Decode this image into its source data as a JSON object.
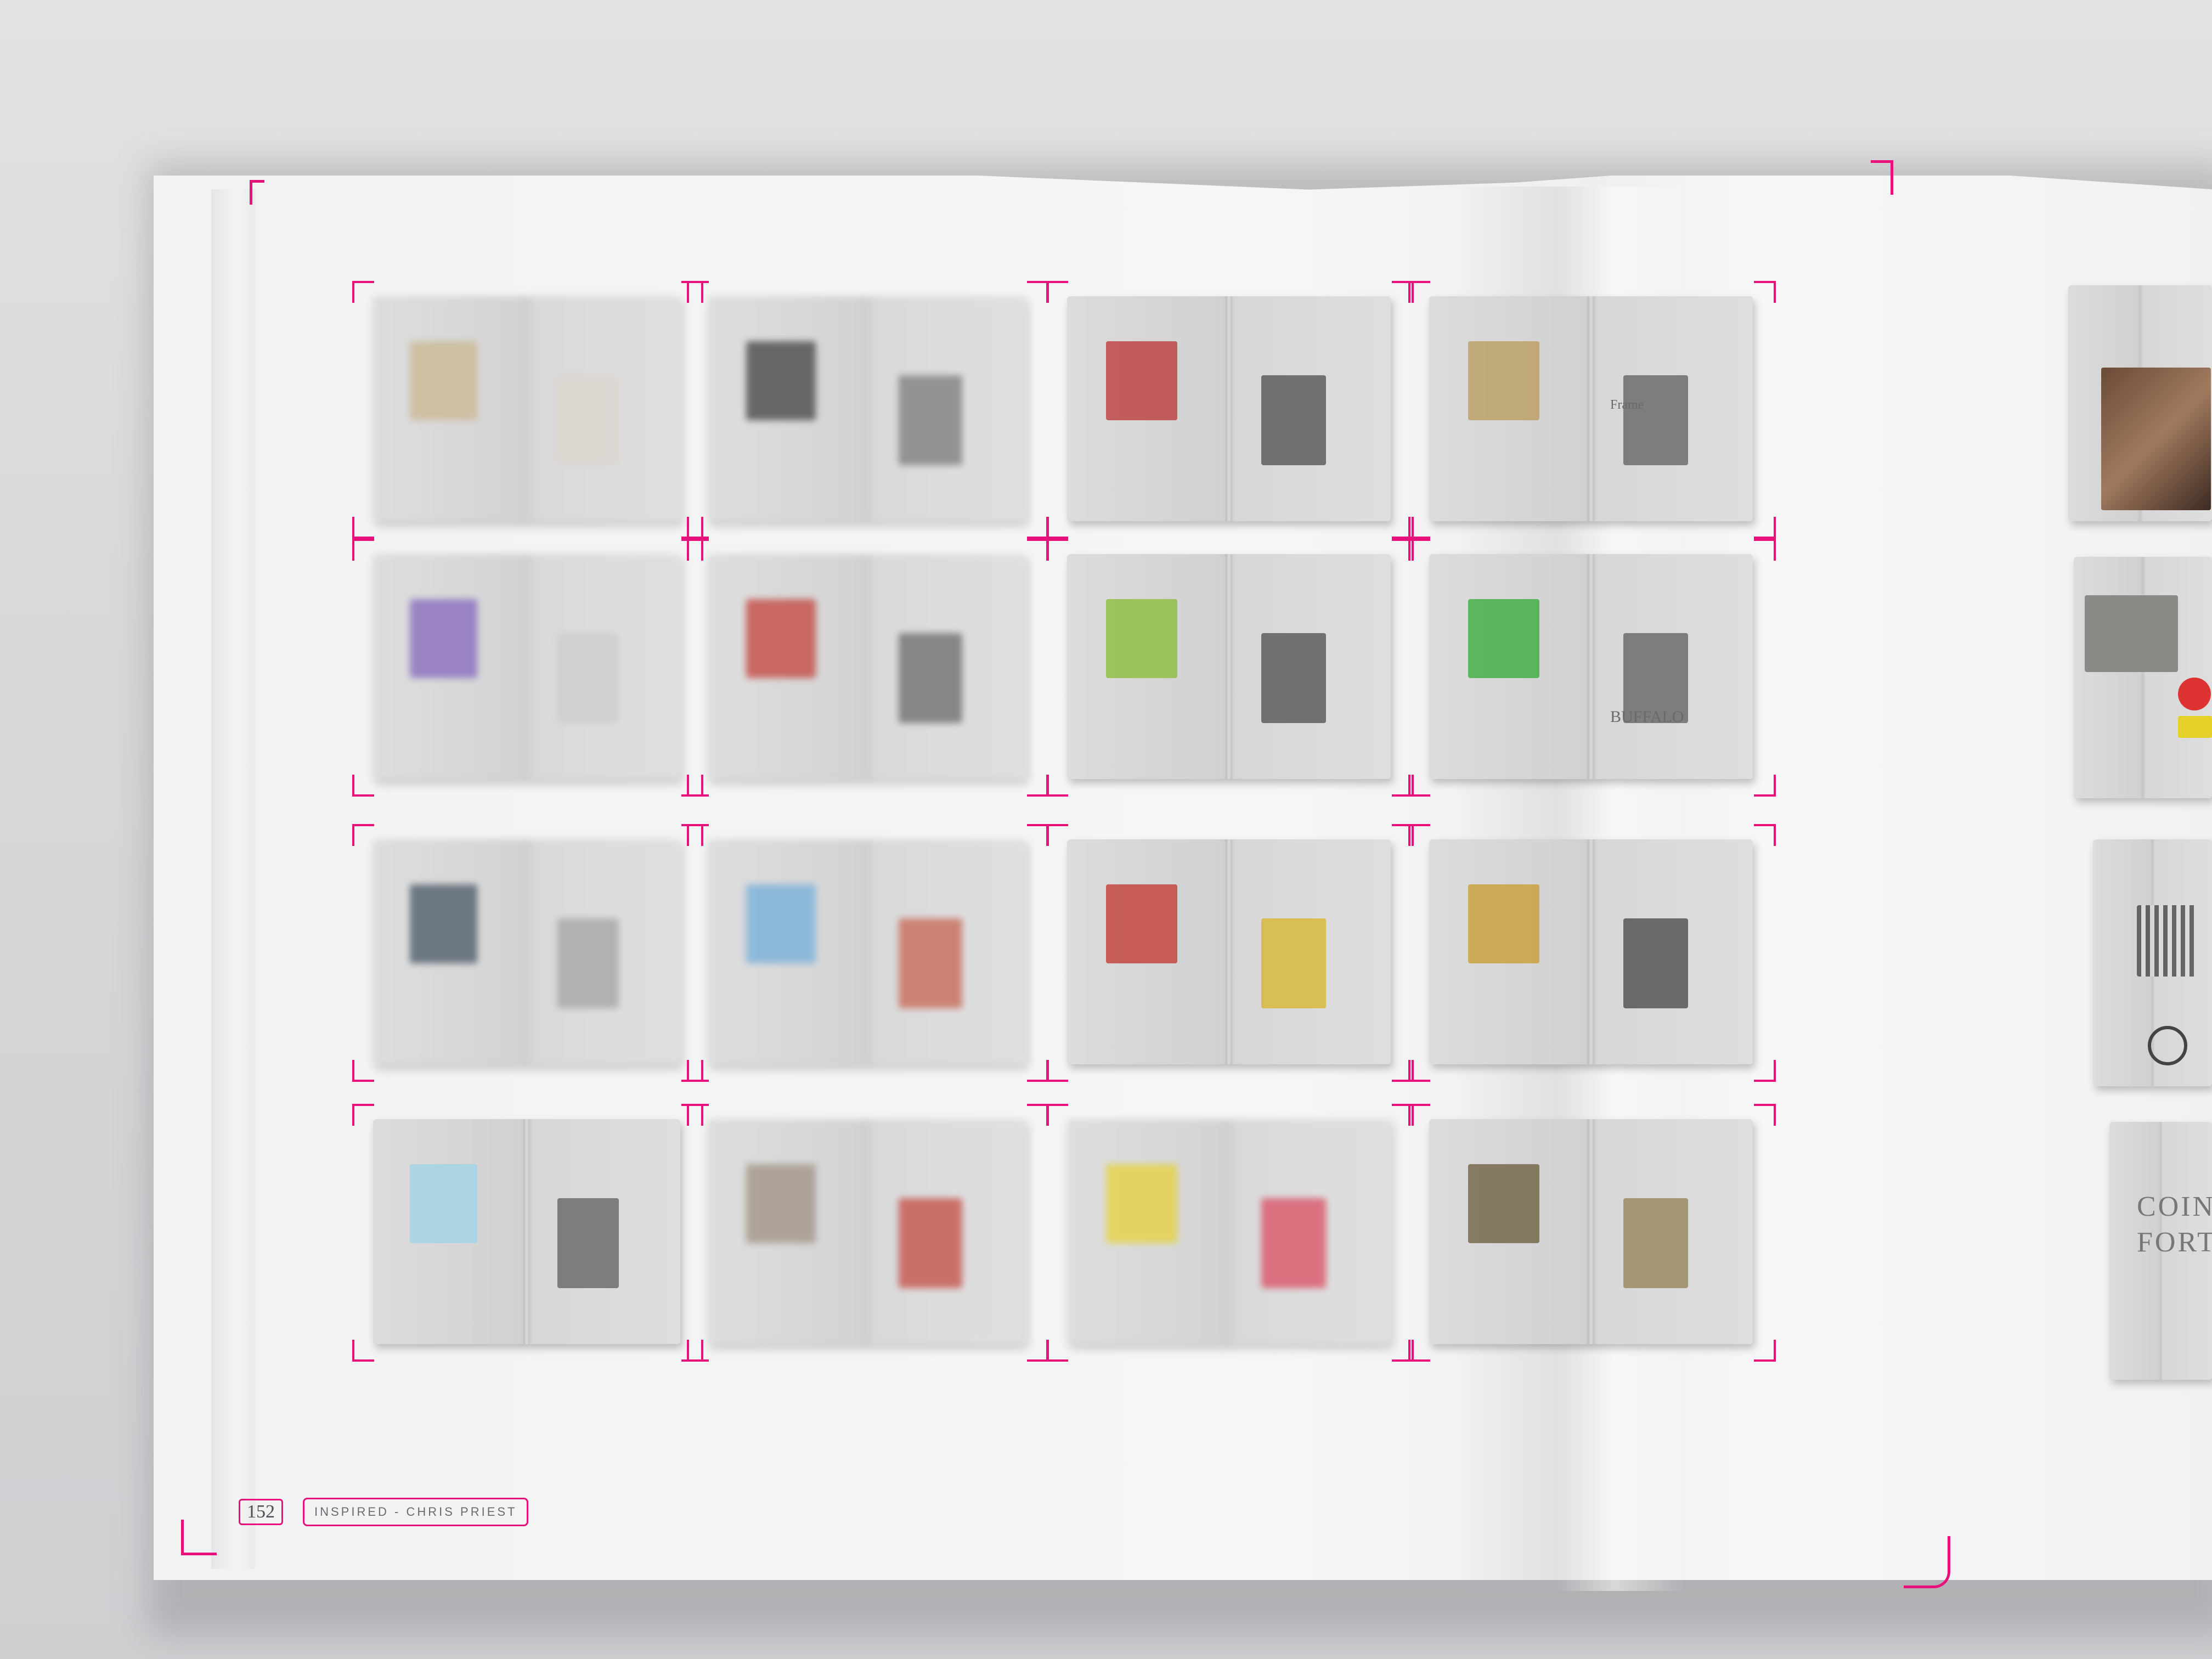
{
  "page": {
    "page_number": "152",
    "running_head": "INSPIRED - CHRIS PRIEST"
  },
  "colors": {
    "annotation_ink": "#e8107a",
    "paper": "#f4f4f5",
    "background": "#d8d8da"
  },
  "photo_description_free": true,
  "thumbnails": {
    "visible_fragments": {
      "frame": "Frame",
      "buffalo": "BUFFALO",
      "coing": "COING",
      "fort": "FORT"
    }
  }
}
